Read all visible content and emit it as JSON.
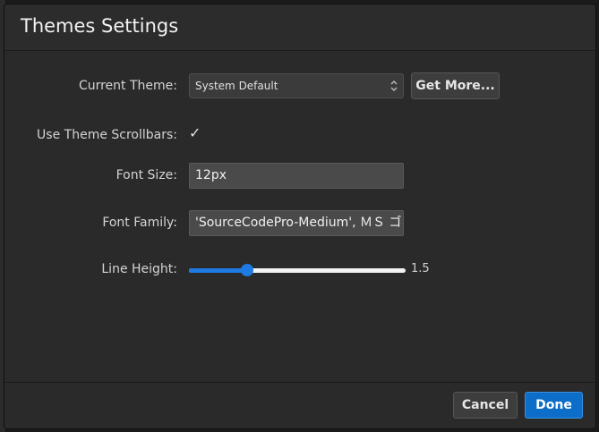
{
  "dialog": {
    "title": "Themes Settings"
  },
  "settings": {
    "current_theme": {
      "label": "Current Theme:",
      "value": "System Default",
      "get_more_label": "Get More..."
    },
    "theme_scrollbars": {
      "label": "Use Theme Scrollbars:",
      "checked": true,
      "check_glyph": "✓"
    },
    "font_size": {
      "label": "Font Size:",
      "value": "12px"
    },
    "font_family": {
      "label": "Font Family:",
      "value": "'SourceCodePro-Medium', ＭＳ ゴシック"
    },
    "line_height": {
      "label": "Line Height:",
      "value": 1.5,
      "display": "1.5",
      "fraction": 0.27
    }
  },
  "footer": {
    "cancel_label": "Cancel",
    "done_label": "Done"
  },
  "colors": {
    "accent": "#0c6ec8",
    "slider": "#1e7be3",
    "dialog_bg": "#2c2c2c"
  },
  "icons": {
    "select_arrows": "updown-chevron-icon",
    "checkbox": "checkmark-icon"
  }
}
